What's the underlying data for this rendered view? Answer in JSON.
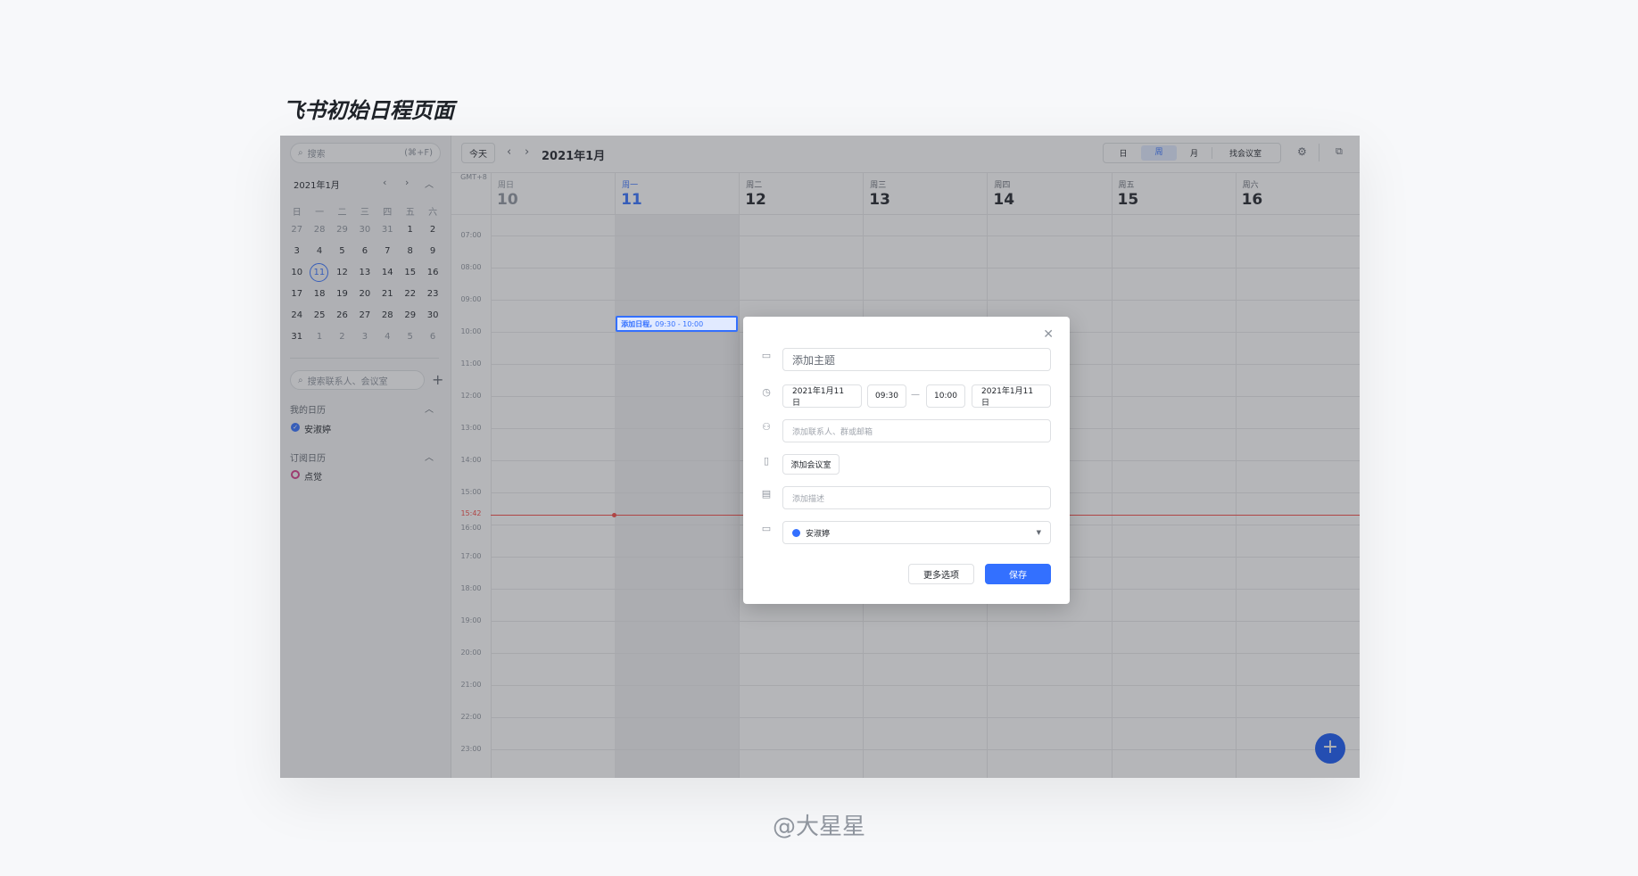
{
  "page_title": "飞书初始日程页面",
  "footer": "@大星星",
  "sidebar": {
    "search_placeholder": "搜索",
    "search_shortcut": "(⌘+F)",
    "month_label": "2021年1月",
    "weekdays": [
      "日",
      "一",
      "二",
      "三",
      "四",
      "五",
      "六"
    ],
    "weeks": [
      [
        "27",
        "28",
        "29",
        "30",
        "31",
        "1",
        "2"
      ],
      [
        "3",
        "4",
        "5",
        "6",
        "7",
        "8",
        "9"
      ],
      [
        "10",
        "11",
        "12",
        "13",
        "14",
        "15",
        "16"
      ],
      [
        "17",
        "18",
        "19",
        "20",
        "21",
        "22",
        "23"
      ],
      [
        "24",
        "25",
        "26",
        "27",
        "28",
        "29",
        "30"
      ],
      [
        "31",
        "1",
        "2",
        "3",
        "4",
        "5",
        "6"
      ]
    ],
    "contact_search_placeholder": "搜索联系人、会议室",
    "my_calendars_label": "我的日历",
    "my_calendar": "安淑婷",
    "subscribed_label": "订阅日历",
    "subscribed_calendar": "点觉"
  },
  "toolbar": {
    "today": "今天",
    "title": "2021年1月",
    "views": [
      "日",
      "周",
      "月"
    ],
    "find_room": "找会议室"
  },
  "week": {
    "timezone": "GMT+8",
    "days": [
      {
        "w": "周日",
        "d": "10"
      },
      {
        "w": "周一",
        "d": "11"
      },
      {
        "w": "周二",
        "d": "12"
      },
      {
        "w": "周三",
        "d": "13"
      },
      {
        "w": "周四",
        "d": "14"
      },
      {
        "w": "周五",
        "d": "15"
      },
      {
        "w": "周六",
        "d": "16"
      }
    ],
    "hours": [
      "07:00",
      "08:00",
      "09:00",
      "10:00",
      "11:00",
      "12:00",
      "13:00",
      "14:00",
      "15:00",
      "16:00",
      "17:00",
      "18:00",
      "19:00",
      "20:00",
      "21:00",
      "22:00",
      "23:00"
    ],
    "now": "15:42",
    "event": {
      "title": "添加日程,",
      "time": "09:30 - 10:00"
    }
  },
  "modal": {
    "subject_placeholder": "添加主题",
    "start_date": "2021年1月11日",
    "start_time": "09:30",
    "dash": "—",
    "end_time": "10:00",
    "end_date": "2021年1月11日",
    "attendees_placeholder": "添加联系人、群或邮箱",
    "add_room": "添加会议室",
    "desc_placeholder": "添加描述",
    "calendar": "安淑婷",
    "more": "更多选项",
    "save": "保存"
  },
  "colors": {
    "accent": "#3370ff",
    "now": "#f54a45"
  }
}
